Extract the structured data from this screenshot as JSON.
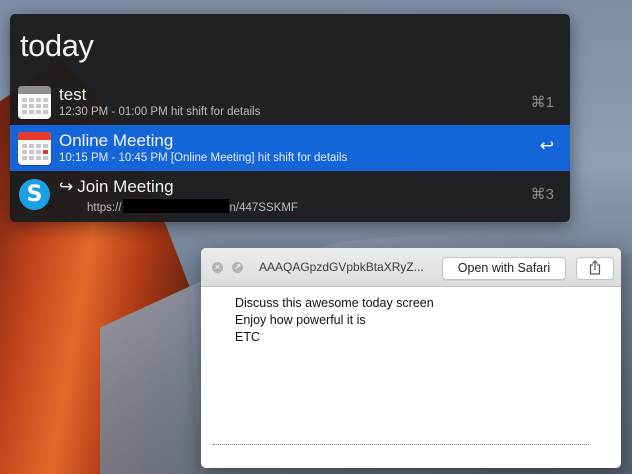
{
  "launcher": {
    "query": "today",
    "results": [
      {
        "icon": "calendar-icon",
        "title": "test",
        "subtitle": "12:30 PM - 01:00 PM hit shift for details",
        "shortcut": "⌘1",
        "selected": false
      },
      {
        "icon": "calendar-icon",
        "title": "Online Meeting",
        "subtitle": "10:15 PM - 10:45 PM [Online Meeting] hit shift for details",
        "shortcut": "↩",
        "selected": true
      },
      {
        "icon": "skype-icon",
        "title_prefix": "↪",
        "title": "Join Meeting",
        "subtitle_prefix": "https://",
        "subtitle_suffix": "n/447SSKMF",
        "shortcut": "⌘3",
        "selected": false
      }
    ]
  },
  "preview_window": {
    "title": "AAAQAGpzdGVpbkBtaXRyZ...",
    "open_button_label": "Open with Safari",
    "share_icon": "share-icon",
    "content_lines": [
      "Discuss this awesome today screen",
      "Enjoy how powerful it is",
      "ETC"
    ]
  },
  "colors": {
    "selection": "#1465d8",
    "launcher_bg": "#1c1c1e",
    "calendar_accent": "#e8392e",
    "skype_blue": "#1aa1e6"
  }
}
